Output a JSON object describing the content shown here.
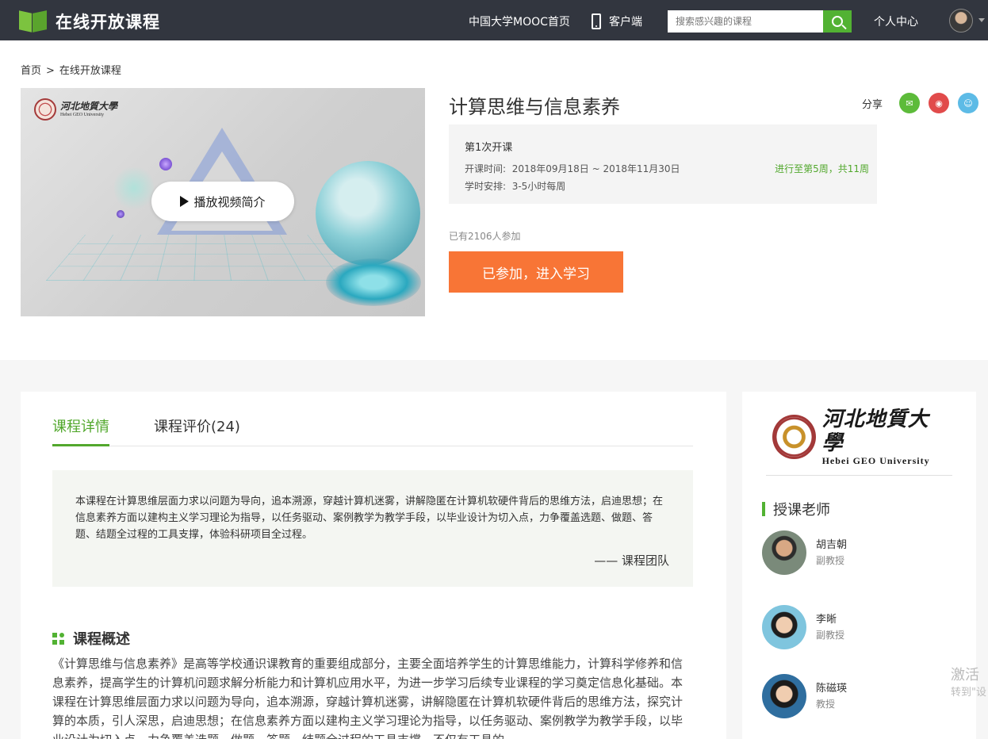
{
  "nav": {
    "logo_text": "在线开放课程",
    "home_link": "中国大学MOOC首页",
    "app_link": "客户端",
    "search_placeholder": "搜索感兴趣的课程",
    "user_center": "个人中心",
    "accent": "#52b233"
  },
  "breadcrumb": {
    "home": "首页",
    "separator": ">",
    "current": "在线开放课程"
  },
  "video": {
    "logo_cn": "河北地質大學",
    "logo_en": "Hebei GEO University",
    "play_label": "播放视频简介"
  },
  "course": {
    "title": "计算思维与信息素养",
    "share_label": "分享",
    "share_icons": [
      "wechat-icon",
      "weibo-icon",
      "qq-icon"
    ],
    "term": "第1次开课",
    "dates_label": "开课时间:",
    "dates_value": "2018年09月18日 ~ 2018年11月30日",
    "hours_label": "学时安排:",
    "hours_value": "3-5小时每周",
    "progress": "进行至第5周，共11周",
    "enrolled": "已有2106人参加",
    "enter_button": "已参加，进入学习",
    "button_color": "#f87536"
  },
  "tabs": [
    {
      "label": "课程详情"
    },
    {
      "label": "课程评价(24)"
    }
  ],
  "quote": {
    "text": "本课程在计算思维层面力求以问题为导向，追本溯源，穿越计算机迷雾，讲解隐匿在计算机软硬件背后的思维方法，启迪思想；在信息素养方面以建构主义学习理论为指导，以任务驱动、案例教学为教学手段，以毕业设计为切入点，力争覆盖选题、做题、答题、结题全过程的工具支撑，体验科研项目全过程。",
    "signature": "—— 课程团队"
  },
  "overview": {
    "title": "课程概述",
    "text": "《计算思维与信息素养》是高等学校通识课教育的重要组成部分，主要全面培养学生的计算思维能力，计算科学修养和信息素养，提高学生的计算机问题求解分析能力和计算机应用水平，为进一步学习后续专业课程的学习奠定信息化基础。本课程在计算思维层面力求以问题为导向，追本溯源，穿越计算机迷雾，讲解隐匿在计算机软硬件背后的思维方法，探究计算的本质，引人深思，启迪思想；在信息素养方面以建构主义学习理论为指导，以任务驱动、案例教学为教学手段，以毕业设计为切入点，力争覆盖选题、做题、答题、结题全过程的工具支撑，不仅有工具的"
  },
  "sidebar": {
    "uni_cn": "河北地質大學",
    "uni_en": "Hebei GEO University",
    "teachers_title": "授课老师",
    "teachers": [
      {
        "name": "胡吉朝",
        "role": "副教授"
      },
      {
        "name": "李晰",
        "role": "副教授"
      },
      {
        "name": "陈磁瑛",
        "role": "教授"
      }
    ]
  },
  "watermark": {
    "line1": "激活",
    "line2": "转到\"设"
  }
}
